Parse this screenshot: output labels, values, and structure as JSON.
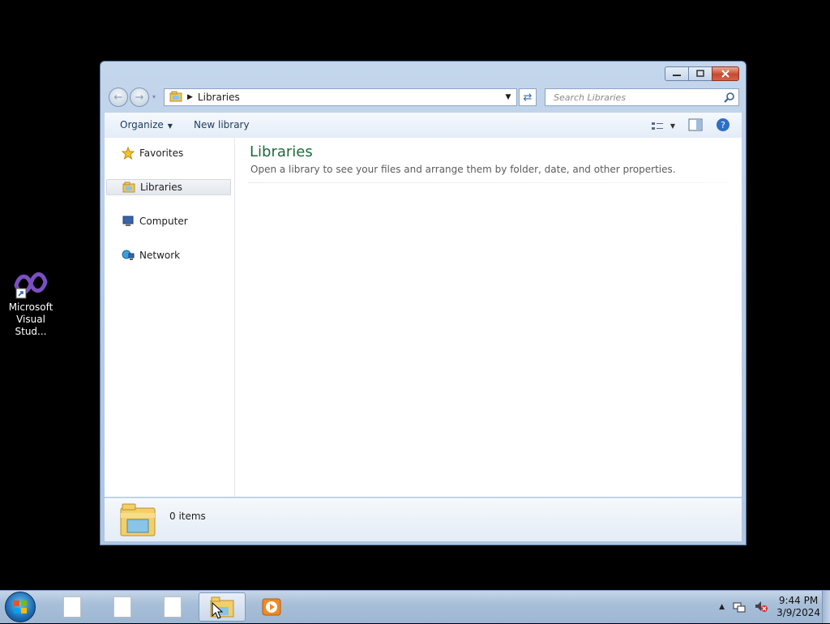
{
  "desktop": {
    "icons": [
      {
        "label": "Microsoft\nVisual Stud...",
        "icon": "visual-studio-icon"
      }
    ]
  },
  "window": {
    "address": {
      "crumbs": [
        "Libraries"
      ]
    },
    "search": {
      "placeholder": "Search Libraries"
    },
    "commands": {
      "organize": "Organize",
      "new_library": "New library"
    },
    "nav": {
      "items": [
        {
          "label": "Favorites",
          "icon": "star-icon"
        },
        {
          "label": "Libraries",
          "icon": "libraries-icon",
          "selected": true
        },
        {
          "label": "Computer",
          "icon": "computer-icon"
        },
        {
          "label": "Network",
          "icon": "network-icon"
        }
      ]
    },
    "main": {
      "title": "Libraries",
      "subtitle": "Open a library to see your files and arrange them by folder, date, and other properties."
    },
    "details": {
      "count": "0 items"
    }
  },
  "taskbar": {
    "buttons": [
      "document-icon",
      "document-icon",
      "document-icon",
      "libraries-icon",
      "media-player-icon"
    ],
    "clock": {
      "time": "9:44 PM",
      "date": "3/9/2024"
    }
  },
  "colors": {
    "title": "#1d6a3c",
    "close": "#c9482f",
    "accent": "#2f6ab8"
  }
}
